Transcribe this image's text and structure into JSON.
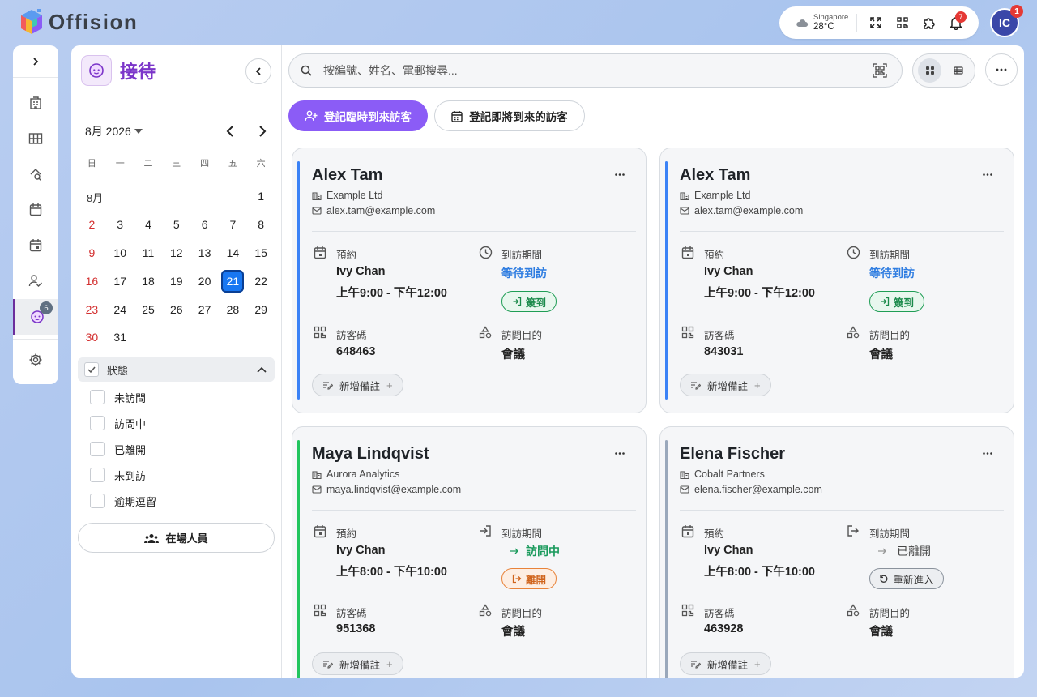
{
  "app": {
    "name": "Offision"
  },
  "topbar": {
    "weather_city": "Singapore",
    "weather_temp": "28°C",
    "notification_count": "7",
    "avatar_initials": "IC",
    "avatar_badge": "1"
  },
  "rail": {
    "visitors_badge": "6"
  },
  "side": {
    "title": "接待",
    "month_select": "8月 2026",
    "weekdays": [
      "日",
      "一",
      "二",
      "三",
      "四",
      "五",
      "六"
    ],
    "month_label": "8月",
    "selected_day": "21",
    "status_header": "狀態",
    "status_items": [
      "未訪問",
      "訪問中",
      "已離開",
      "未到訪",
      "逾期逗留"
    ],
    "onsite_button": "在場人員"
  },
  "search": {
    "placeholder": "按編號、姓名、電郵搜尋..."
  },
  "actions": {
    "walkin_button": "登記臨時到來訪客",
    "upcoming_button": "登記即將到來的訪客"
  },
  "labels": {
    "appointment": "預約",
    "visit_period": "到訪期間",
    "visitor_code": "訪客碼",
    "purpose": "訪問目的",
    "add_note": "新增備註"
  },
  "cards": [
    {
      "name": "Alex Tam",
      "company": "Example Ltd",
      "email": "alex.tam@example.com",
      "host": "Ivy Chan",
      "time": "上午9:00 - 下午12:00",
      "status": "等待到訪",
      "action": "簽到",
      "code": "648463",
      "purpose": "會議",
      "accent": "#3b82f6"
    },
    {
      "name": "Alex Tam",
      "company": "Example Ltd",
      "email": "alex.tam@example.com",
      "host": "Ivy Chan",
      "time": "上午9:00 - 下午12:00",
      "status": "等待到訪",
      "action": "簽到",
      "code": "843031",
      "purpose": "會議",
      "accent": "#3b82f6"
    },
    {
      "name": "Maya Lindqvist",
      "company": "Aurora Analytics",
      "email": "maya.lindqvist@example.com",
      "host": "Ivy Chan",
      "time": "上午8:00 - 下午10:00",
      "status": "訪問中",
      "action": "離開",
      "code": "951368",
      "purpose": "會議",
      "accent": "#22c55e"
    },
    {
      "name": "Elena Fischer",
      "company": "Cobalt Partners",
      "email": "elena.fischer@example.com",
      "host": "Ivy Chan",
      "time": "上午8:00 - 下午10:00",
      "status": "已離開",
      "action": "重新進入",
      "code": "463928",
      "purpose": "會議",
      "accent": "#9aa8bb"
    }
  ]
}
